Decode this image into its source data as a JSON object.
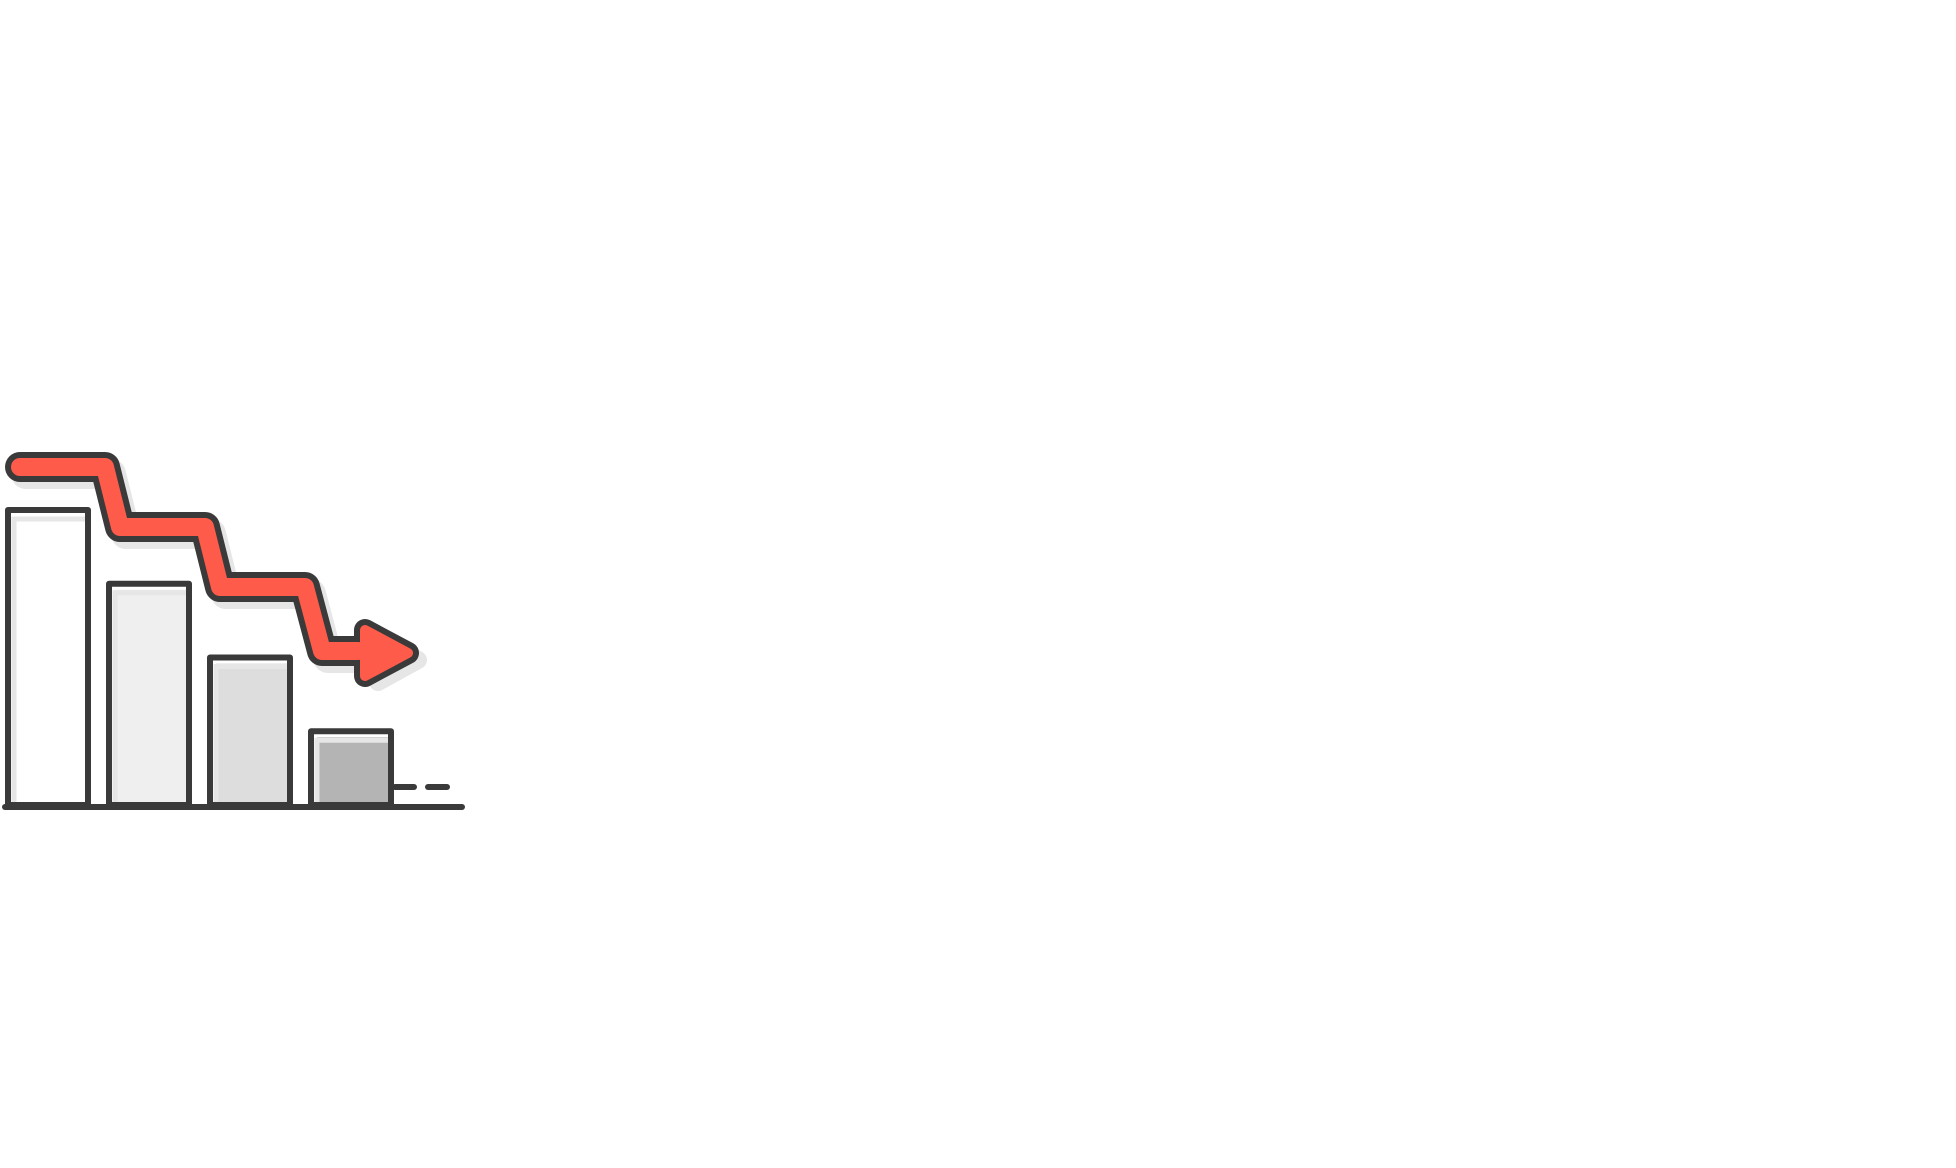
{
  "illustration": {
    "icon": "declining-bar-chart-with-downward-arrow-icon",
    "colors": {
      "outline": "#3a3a3a",
      "arrow": "#ff5b4a",
      "shadow": "#e6e6e6",
      "bars": [
        "#ffffff",
        "#efefef",
        "#dddddd",
        "#b4b4b4"
      ]
    },
    "relative_bar_levels": [
      1.0,
      0.75,
      0.5,
      0.25
    ],
    "trend": "downward"
  }
}
